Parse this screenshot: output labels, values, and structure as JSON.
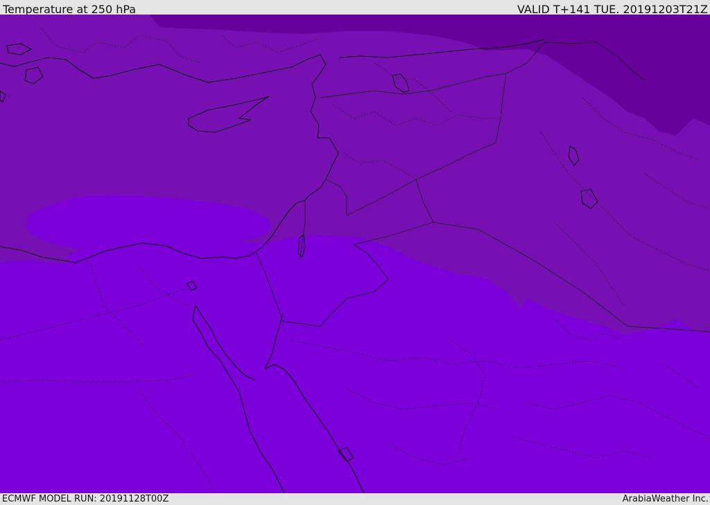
{
  "header": {
    "title": "Temperature at 250 hPa",
    "valid": "VALID T+141 TUE. 20191203T21Z"
  },
  "footer": {
    "model_run": "ECMWF MODEL RUN: 20191128T00Z",
    "credit": "ArabiaWeather Inc."
  },
  "map": {
    "colors": {
      "band_warm": "#7b00d9",
      "band_mid": "#7710b3",
      "band_cold": "#66029b",
      "coastline": "#111111",
      "border": "#222222"
    }
  }
}
